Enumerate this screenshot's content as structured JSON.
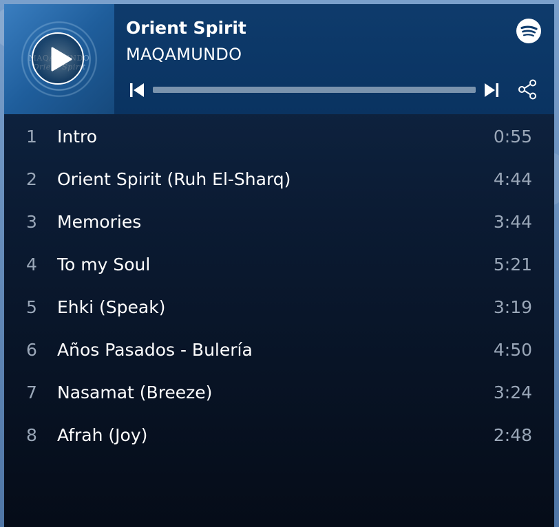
{
  "album": {
    "title": "Orient Spirit",
    "artist": "MAQAMUNDO",
    "cover_text_line1": "MAQAMUNDO",
    "cover_text_line2": "Orient Spirit"
  },
  "controls": {
    "play_icon": "play-icon",
    "prev_icon": "skip-previous-icon",
    "next_icon": "skip-next-icon",
    "share_icon": "share-icon",
    "brand_icon": "spotify-logo-icon",
    "progress": 0
  },
  "colors": {
    "header_bg": "#0e3b6c",
    "list_bg_top": "#10294a",
    "list_bg_bottom": "#050c18",
    "text_primary": "#ffffff",
    "text_secondary": "#9aa7b8",
    "progress_track": "#7a93ad"
  },
  "tracks": [
    {
      "num": "1",
      "title": "Intro",
      "duration": "0:55"
    },
    {
      "num": "2",
      "title": "Orient Spirit (Ruh El-Sharq)",
      "duration": "4:44"
    },
    {
      "num": "3",
      "title": "Memories",
      "duration": "3:44"
    },
    {
      "num": "4",
      "title": "To my Soul",
      "duration": "5:21"
    },
    {
      "num": "5",
      "title": "Ehki (Speak)",
      "duration": "3:19"
    },
    {
      "num": "6",
      "title": "Años Pasados - Bulería",
      "duration": "4:50"
    },
    {
      "num": "7",
      "title": "Nasamat (Breeze)",
      "duration": "3:24"
    },
    {
      "num": "8",
      "title": "Afrah (Joy)",
      "duration": "2:48"
    }
  ]
}
